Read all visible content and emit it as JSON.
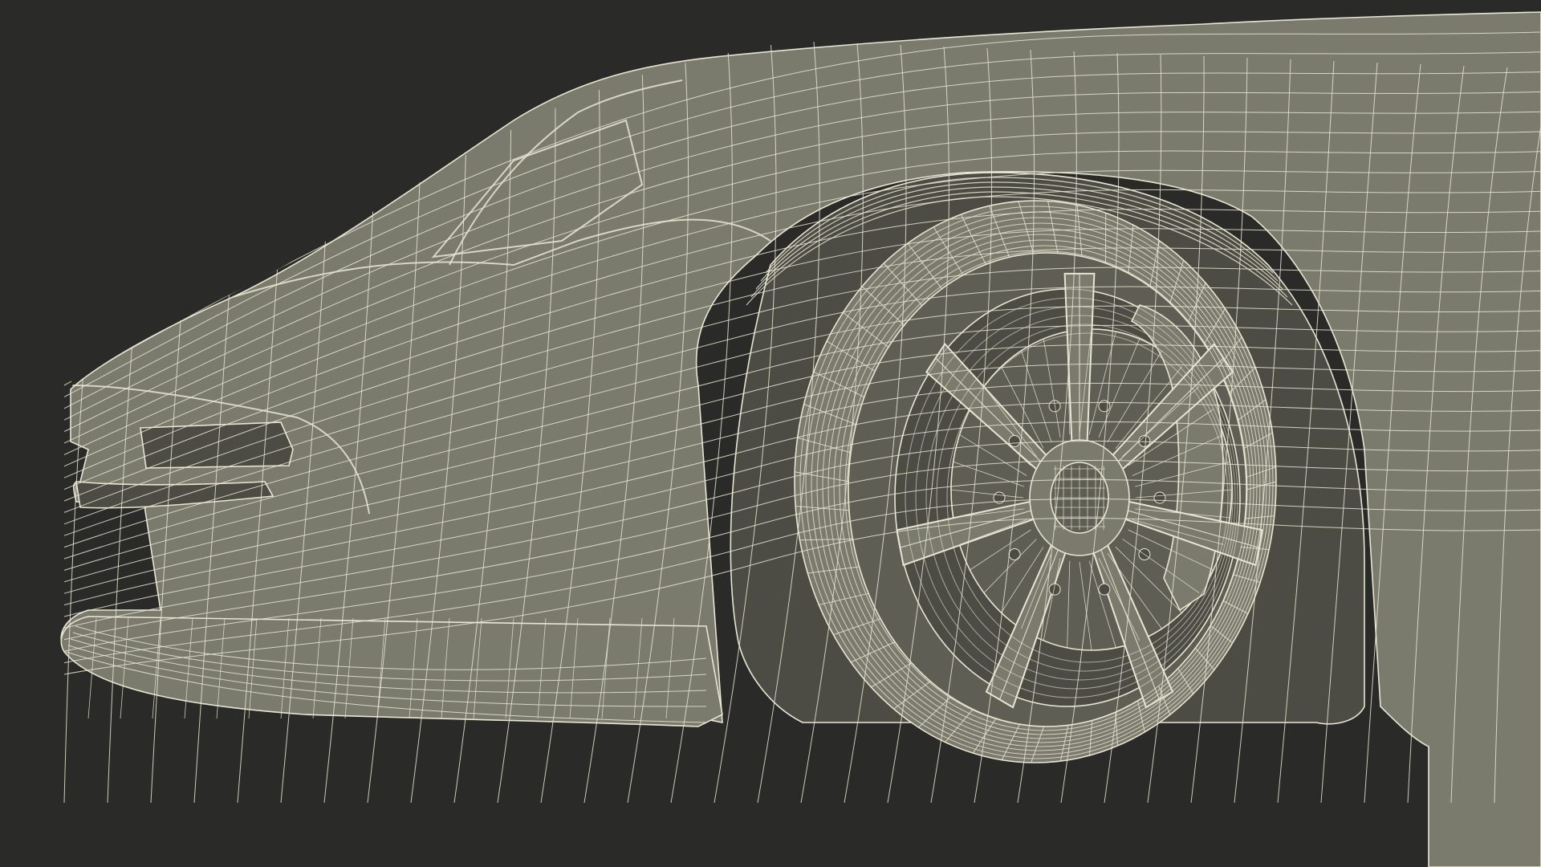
{
  "render": {
    "background": "#2a2a29",
    "body_color": "#7a7a6d",
    "body_shadow_color": "#5e5e54",
    "body_dark_color": "#4c4c44",
    "wire_color": "#e8e6d2",
    "subject": "car-front-wireframe"
  },
  "wheel": {
    "spoke_count": 7
  }
}
